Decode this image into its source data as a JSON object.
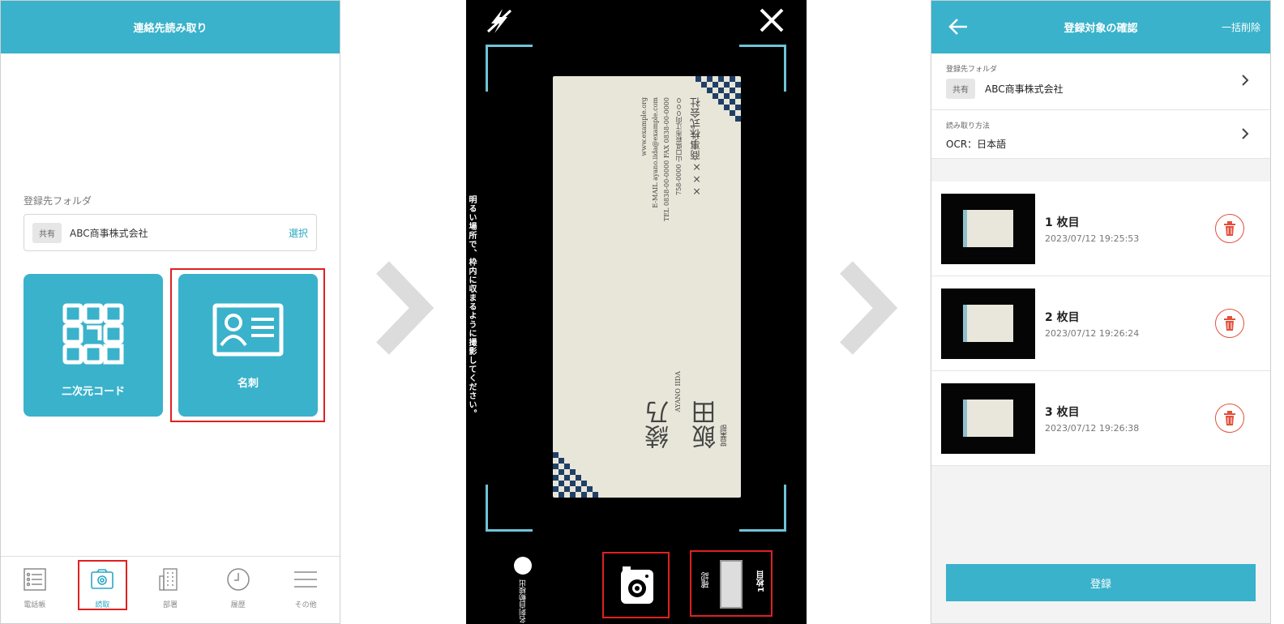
{
  "screen1": {
    "title": "連絡先読み取り",
    "folder_label": "登録先フォルダ",
    "folder_tag": "共有",
    "folder_name": "ABC商事株式会社",
    "select_label": "選択",
    "tiles": [
      {
        "label": "二次元コード",
        "icon": "qr-code-icon"
      },
      {
        "label": "名刺",
        "icon": "business-card-icon"
      }
    ],
    "nav": [
      {
        "label": "電話帳",
        "icon": "phonebook-icon"
      },
      {
        "label": "読取",
        "icon": "camera-icon",
        "active": true
      },
      {
        "label": "部署",
        "icon": "building-icon"
      },
      {
        "label": "履歴",
        "icon": "clock-icon"
      },
      {
        "label": "その他",
        "icon": "menu-icon"
      }
    ]
  },
  "screen2": {
    "guide": "明るい場所で、枠内に収まるように撮影してください。",
    "auto_detect_label": "名刺自動検出",
    "count_label": "1枚目",
    "confirm_label": "確認",
    "card": {
      "company": "×××商事株式会社",
      "address": "758-0000 山口県萩市江向０００",
      "tel": "TEL 0838-00-0000 FAX 0838-00-0000",
      "email": "E-MAIL ayano.iida@example.com",
      "web": "www.example.org",
      "name_latin": "AYANO IIDA",
      "surname": "飯田",
      "given": "綾乃",
      "dept": "営業部"
    }
  },
  "screen3": {
    "title": "登録対象の確認",
    "bulk_delete": "一括削除",
    "folder_label": "登録先フォルダ",
    "folder_tag": "共有",
    "folder_name": "ABC商事株式会社",
    "method_label": "読み取り方法",
    "method_value": "OCR：日本語",
    "items": [
      {
        "title": "1 枚目",
        "date": "2023/07/12 19:25:53"
      },
      {
        "title": "2 枚目",
        "date": "2023/07/12 19:26:24"
      },
      {
        "title": "3 枚目",
        "date": "2023/07/12 19:26:38"
      }
    ],
    "register_label": "登録"
  },
  "colors": {
    "accent": "#3ab2cb",
    "highlight": "#e02020",
    "delete": "#e3503b"
  }
}
